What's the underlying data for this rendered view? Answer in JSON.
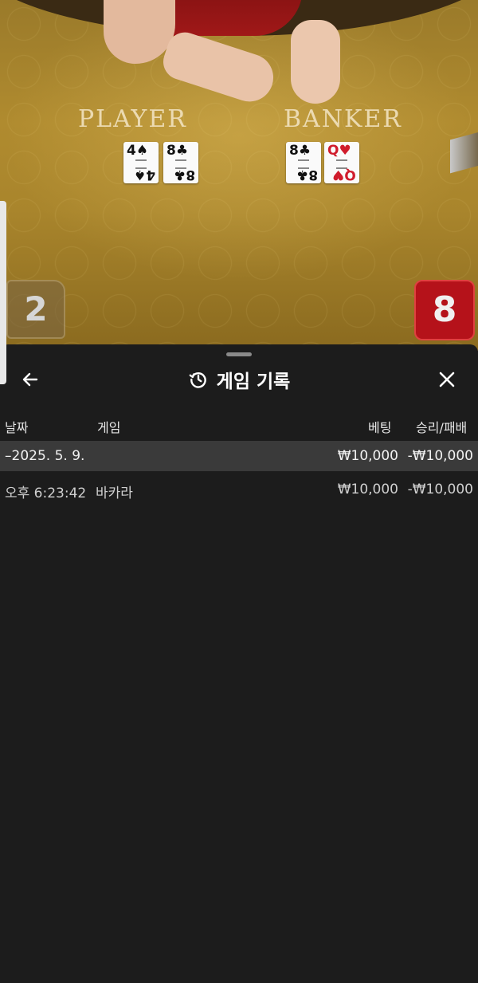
{
  "table": {
    "player_label": "PLAYER",
    "banker_label": "BANKER",
    "player_cards": [
      {
        "rank": "4",
        "suit": "♠",
        "color": "black"
      },
      {
        "rank": "8",
        "suit": "♣",
        "color": "black"
      }
    ],
    "banker_cards": [
      {
        "rank": "8",
        "suit": "♣",
        "color": "black"
      },
      {
        "rank": "Q",
        "suit": "♥",
        "color": "red"
      }
    ],
    "player_score": "2",
    "banker_score": "8"
  },
  "history": {
    "title": "게임 기록",
    "title_icon": "history-icon",
    "back_icon": "arrow-left-icon",
    "close_icon": "close-icon",
    "columns": {
      "date": "날짜",
      "game": "게임",
      "bet": "베팅",
      "result": "승리/패배"
    },
    "date_group": {
      "date": "–2025. 5. 9.",
      "bet": "₩10,000",
      "result": "-₩10,000"
    },
    "rows": [
      {
        "time": "오후 6:23:42",
        "game": "바카라",
        "bet": "₩10,000",
        "result": "-₩10,000"
      }
    ]
  },
  "colors": {
    "sheet_bg": "#1c1c1c",
    "date_row_bg": "#3a3a3a",
    "banker_red": "#b5121a",
    "felt_gold": "#a9852c"
  }
}
